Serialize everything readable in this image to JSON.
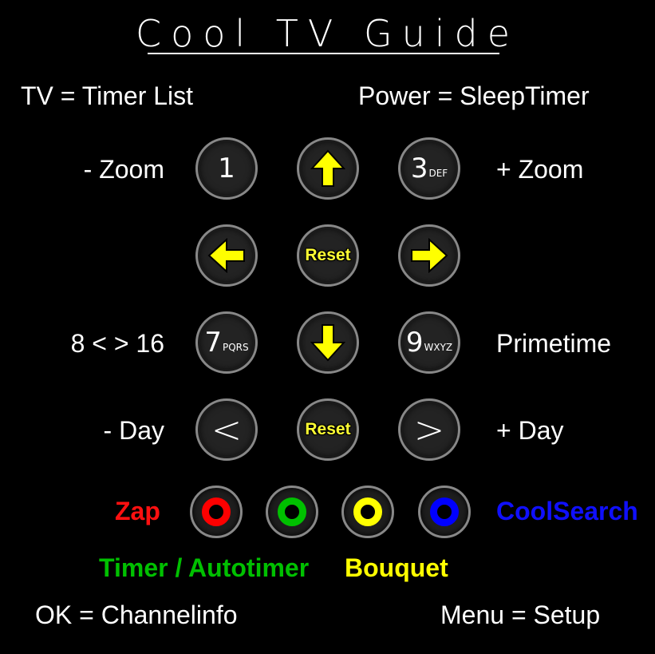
{
  "title": "Cool TV Guide",
  "top": {
    "left": "TV = Timer List",
    "right": "Power = SleepTimer"
  },
  "rows": {
    "zoom_minus": "- Zoom",
    "zoom_plus": "+ Zoom",
    "eight_sixteen": "8 < > 16",
    "primetime": "Primetime",
    "day_minus": "- Day",
    "day_plus": "+ Day"
  },
  "keys": {
    "k1": {
      "main": "1",
      "sub": ""
    },
    "k3": {
      "main": "3",
      "sub": "DEF"
    },
    "k7": {
      "main": "7",
      "sub": "PQRS"
    },
    "k9": {
      "main": "9",
      "sub": "WXYZ"
    },
    "reset1": "Reset",
    "reset2": "Reset",
    "prev": "<",
    "next": ">"
  },
  "color_keys": {
    "zap": "Zap",
    "coolsearch": "CoolSearch",
    "timer": "Timer / Autotimer",
    "bouquet": "Bouquet",
    "colors": {
      "red": "#ff0000",
      "green": "#00c000",
      "yellow": "#ffff00",
      "blue": "#0000ff"
    }
  },
  "bottom": {
    "left": "OK = Channelinfo",
    "right": "Menu = Setup"
  },
  "icons": {
    "up": "arrow-up-icon",
    "left": "arrow-left-icon",
    "right": "arrow-right-icon",
    "down": "arrow-down-icon"
  },
  "accent": "#ffff00"
}
